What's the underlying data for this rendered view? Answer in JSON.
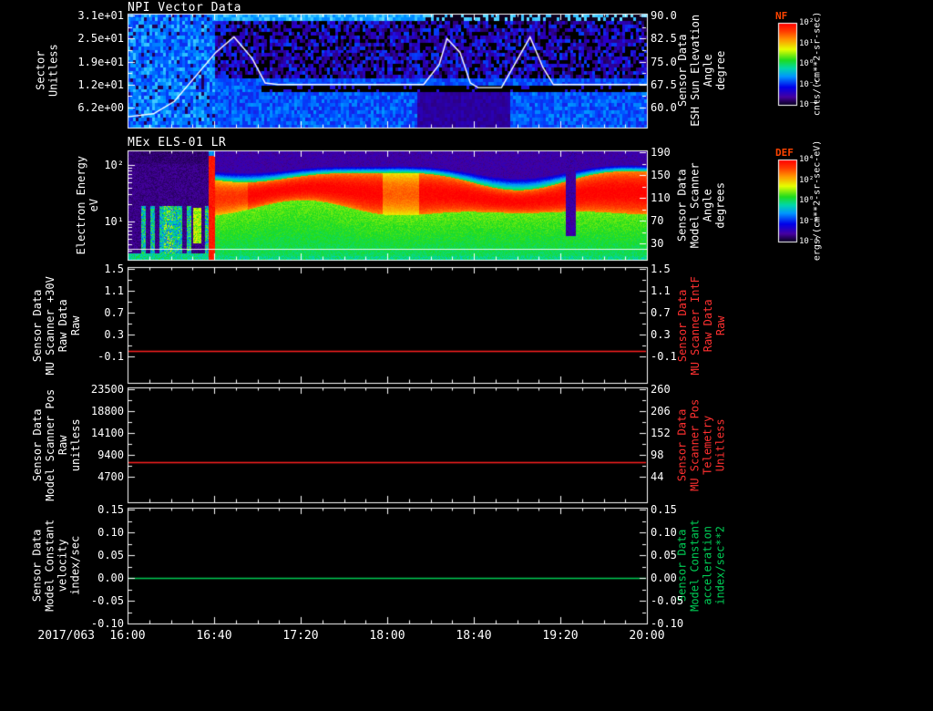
{
  "page": {
    "background": "#000000",
    "foreground": "#ffffff"
  },
  "x_axis": {
    "date_label": "2017/063",
    "ticks": [
      "16:00",
      "16:40",
      "17:20",
      "18:00",
      "18:40",
      "19:20",
      "20:00"
    ]
  },
  "panels": [
    {
      "title": "NPI Vector Data",
      "left_title": "Sector\nUnitless",
      "left_ticks": [
        "3.1e+01",
        "2.5e+01",
        "1.9e+01",
        "1.2e+01",
        "6.2e+00"
      ],
      "right_ticks": [
        "90.0",
        "82.5",
        "75.0",
        "67.5",
        "60.0"
      ],
      "right_title": "Sensor Data\nESH Sun Elevation\nAngle\ndegree",
      "right_title_color": "#ffffff"
    },
    {
      "title": "MEx ELS-01 LR",
      "left_title": "Electron Energy\neV",
      "left_ticks": [
        "10²",
        "10¹"
      ],
      "right_ticks": [
        "190",
        "150",
        "110",
        "70",
        "30"
      ],
      "right_title": "Sensor Data\nModel Scanner\nAngle\ndegrees",
      "right_title_color": "#ffffff"
    },
    {
      "title": "",
      "left_title": "Sensor Data\nMU Scanner +30V\nRaw Data\nRaw",
      "left_ticks": [
        "1.5",
        "1.1",
        "0.7",
        "0.3",
        "-0.1"
      ],
      "right_ticks": [
        "1.5",
        "1.1",
        "0.7",
        "0.3",
        "-0.1"
      ],
      "right_title": "Sensor Data\nMU Scanner IntF\nRaw Data\nRaw",
      "right_title_color": "#ff3030"
    },
    {
      "title": "",
      "left_title": "Sensor Data\nModel Scanner Pos\nRaw\nunitless",
      "left_ticks": [
        "23500",
        "18800",
        "14100",
        "9400",
        "4700"
      ],
      "right_ticks": [
        "260",
        "206",
        "152",
        "98",
        "44"
      ],
      "right_title": "Sensor Data\nMU Scanner Pos\nTelemetry\nUnitless",
      "right_title_color": "#ff3030"
    },
    {
      "title": "",
      "left_title": "Sensor Data\nModel Constant\nvelocity\nindex/sec",
      "left_ticks": [
        "0.15",
        "0.10",
        "0.05",
        "0.00",
        "-0.05",
        "-0.10"
      ],
      "right_ticks": [
        "0.15",
        "0.10",
        "0.05",
        "0.00",
        "-0.05",
        "-0.10"
      ],
      "right_title": "Sensor Data\nModel Constant\nacceleration\nindex/sec**2",
      "right_title_color": "#00cc55"
    }
  ],
  "colorbars": [
    {
      "title": "NF",
      "title_color": "#ff4400",
      "unit": "cnts/(cm**2-sr-sec)",
      "ticks": [
        "10²",
        "10¹",
        "10⁰",
        "10⁻¹",
        "10⁻²"
      ]
    },
    {
      "title": "DEF",
      "title_color": "#ff4400",
      "unit": "ergs/(cm**2-sr-sec-eV)",
      "ticks": [
        "10⁴",
        "10²",
        "10⁰",
        "10⁻²",
        "10⁻⁴"
      ]
    }
  ],
  "chart_data": [
    {
      "type": "heatmap",
      "title": "NPI Vector Data",
      "x_range": [
        "2017/063 16:00",
        "2017/063 20:00"
      ],
      "ylabel": "Sector (Unitless)",
      "y_ticks": [
        31,
        25,
        19,
        12,
        6.2
      ],
      "colorbar": {
        "name": "NF",
        "unit": "cnts/(cm**2-sr-sec)",
        "scale": "log",
        "ticks_log10": [
          2,
          1,
          0,
          -1,
          -2
        ]
      },
      "description": "Ion counts per sector vs time: bright blue/cyan columns before ~16:40; afterwards speckled dark-purple/black upper sectors, a black horizontal band near sector ~12 from ~16:45 onward, brighter cyan low sectors with a darker purple patch ~18:15-18:55.",
      "overlay_line": {
        "name": "ESH Sun Elevation Angle (right axis, degree)",
        "color": "#ffffff",
        "axis_range": [
          60,
          90
        ],
        "points_frac_value": [
          [
            0,
            57
          ],
          [
            0.05,
            58
          ],
          [
            0.09,
            62
          ],
          [
            0.13,
            70
          ],
          [
            0.17,
            78
          ],
          [
            0.205,
            83
          ],
          [
            0.24,
            76
          ],
          [
            0.265,
            68
          ],
          [
            0.29,
            67.5
          ],
          [
            0.57,
            67.5
          ],
          [
            0.6,
            74
          ],
          [
            0.615,
            82.5
          ],
          [
            0.64,
            78
          ],
          [
            0.66,
            68
          ],
          [
            0.675,
            66.5
          ],
          [
            0.72,
            66.5
          ],
          [
            0.745,
            74
          ],
          [
            0.775,
            83
          ],
          [
            0.8,
            73
          ],
          [
            0.82,
            67.5
          ],
          [
            1.0,
            67.5
          ]
        ]
      }
    },
    {
      "type": "heatmap",
      "title": "MEx ELS-01 LR",
      "x_range": [
        "2017/063 16:00",
        "2017/063 20:00"
      ],
      "ylabel": "Electron Energy (eV)",
      "yscale": "log",
      "y_ticks": [
        100,
        10
      ],
      "right_axis": {
        "label": "Sensor Data Model Scanner Angle (degrees)",
        "ticks": [
          190,
          150,
          110,
          70,
          30
        ]
      },
      "colorbar": {
        "name": "DEF",
        "unit": "ergs/(cm**2-sr-sec-eV)",
        "scale": "log",
        "ticks_log10": [
          4,
          2,
          0,
          -2,
          -4
        ]
      },
      "description": "Electron energy-flux spectrogram: sparse green/cyan low-energy bursts 16:00-16:30 over dark background, intense narrow red burst ~16:33, then continuous intense red band ~20-100 eV from ~16:55 to 20:00 with green flanks, navy at high energies, brief dropout ~19:25."
    },
    {
      "type": "line",
      "x_range": [
        "16:00",
        "20:00"
      ],
      "y_ticks": [
        1.5,
        1.1,
        0.7,
        0.3,
        -0.1
      ],
      "right_y_ticks": [
        1.5,
        1.1,
        0.7,
        0.3,
        -0.1
      ],
      "series": [
        {
          "name": "MU Scanner +30V Raw Data (Raw)",
          "color": "#ff2020",
          "constant_value": 0.0
        }
      ]
    },
    {
      "type": "line",
      "x_range": [
        "16:00",
        "20:00"
      ],
      "y_ticks": [
        23500,
        18800,
        14100,
        9400,
        4700
      ],
      "right_y_ticks": [
        260,
        206,
        152,
        98,
        44
      ],
      "series": [
        {
          "name": "Model Scanner Pos Raw (unitless)",
          "color": "#ff2020",
          "constant_value": 7900,
          "right_axis_value": 80
        }
      ]
    },
    {
      "type": "line",
      "x_range": [
        "16:00",
        "20:00"
      ],
      "y_ticks": [
        0.15,
        0.1,
        0.05,
        0.0,
        -0.05,
        -0.1
      ],
      "right_y_ticks": [
        0.15,
        0.1,
        0.05,
        0.0,
        -0.05,
        -0.1
      ],
      "series": [
        {
          "name": "Model Constant velocity (index/sec)",
          "color": "#00cc55",
          "constant_value": 0.0
        }
      ]
    }
  ]
}
